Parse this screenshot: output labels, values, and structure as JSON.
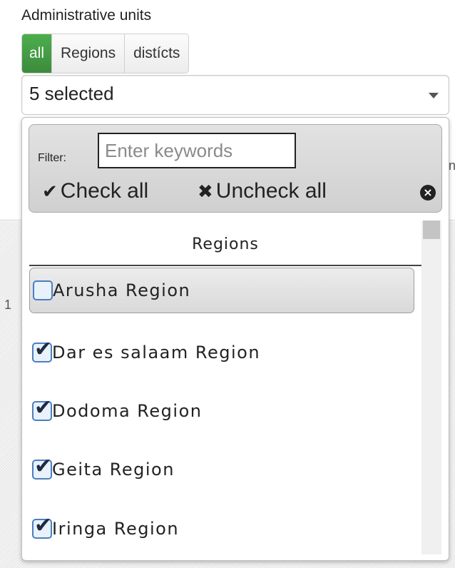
{
  "title": "Administrative units",
  "tabs": [
    {
      "label": "all",
      "active": true
    },
    {
      "label": "Regions",
      "active": false
    },
    {
      "label": "distícts",
      "active": false
    }
  ],
  "select": {
    "value": "5 selected"
  },
  "menu": {
    "filter_label": "Filter:",
    "filter_placeholder": "Enter keywords",
    "check_all": "Check all",
    "uncheck_all": "Uncheck all",
    "group_label": "Regions",
    "items": [
      {
        "label": "Arusha Region",
        "checked": false,
        "hover": true
      },
      {
        "label": "Dar es salaam Region",
        "checked": true,
        "hover": false
      },
      {
        "label": "Dodoma Region",
        "checked": true,
        "hover": false
      },
      {
        "label": "Geita Region",
        "checked": true,
        "hover": false
      },
      {
        "label": "Iringa Region",
        "checked": true,
        "hover": false
      }
    ]
  },
  "background_fragments": {
    "left_digit": "1",
    "right_char": "n"
  }
}
